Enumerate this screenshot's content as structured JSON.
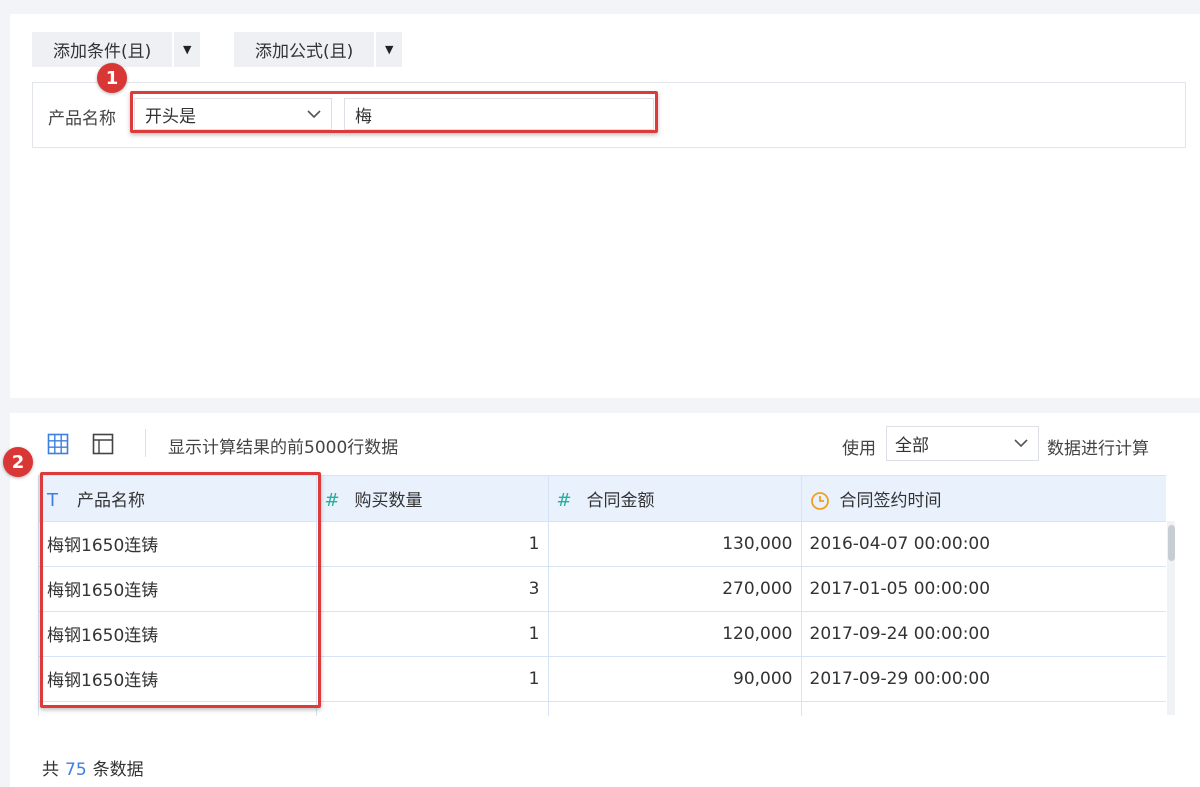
{
  "toolbar": {
    "add_condition_label": "添加条件(且)",
    "add_formula_label": "添加公式(且)"
  },
  "condition": {
    "field_label": "产品名称",
    "operator": "开头是",
    "value": "梅"
  },
  "annotations": {
    "badge1": "1",
    "badge2": "2"
  },
  "preview": {
    "info": "显示计算结果的前5000行数据",
    "use_label": "使用",
    "use_option": "全部",
    "calc_label": "数据进行计算",
    "columns": [
      {
        "label": "产品名称",
        "type_icon": "text-type-icon"
      },
      {
        "label": "购买数量",
        "type_icon": "number-type-icon"
      },
      {
        "label": "合同金额",
        "type_icon": "number-type-icon"
      },
      {
        "label": "合同签约时间",
        "type_icon": "date-type-icon"
      }
    ],
    "rows": [
      [
        "梅钢1650连铸",
        "1",
        "130,000",
        "2016-04-07 00:00:00"
      ],
      [
        "梅钢1650连铸",
        "3",
        "270,000",
        "2017-01-05 00:00:00"
      ],
      [
        "梅钢1650连铸",
        "1",
        "120,000",
        "2017-09-24 00:00:00"
      ],
      [
        "梅钢1650连铸",
        "1",
        "90,000",
        "2017-09-29 00:00:00"
      ]
    ],
    "footer_prefix": "共",
    "footer_count": "75",
    "footer_suffix": "条数据"
  },
  "colors": {
    "accent": "#3d7fe0",
    "highlight_red": "#dd3b3b",
    "header_bg": "#e8f1fc",
    "number_icon": "#23b0a0",
    "date_icon": "#f0a020"
  }
}
